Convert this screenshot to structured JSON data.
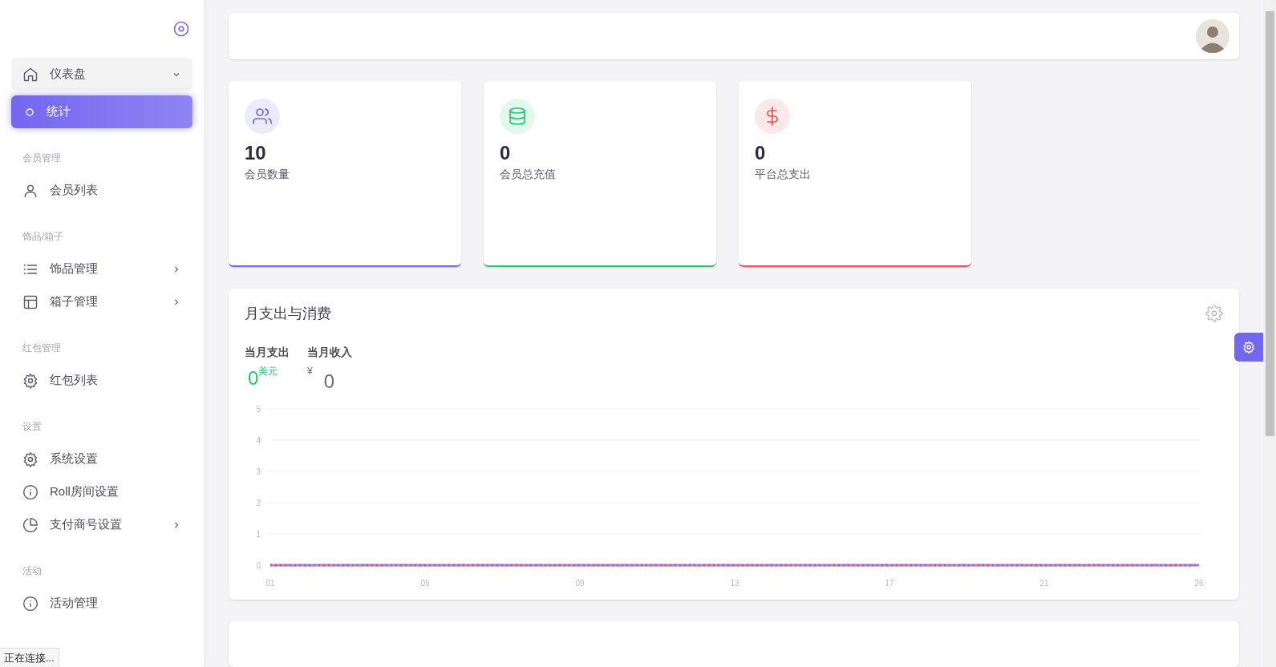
{
  "sidebar": {
    "items": [
      {
        "kind": "group",
        "label": "仪表盘",
        "selected": false,
        "expanded": true,
        "children": [
          {
            "label": "统计",
            "selected": true
          }
        ]
      },
      {
        "kind": "header",
        "label": "会员管理"
      },
      {
        "kind": "link",
        "label": "会员列表",
        "selected": false
      },
      {
        "kind": "header",
        "label": "饰品/箱子"
      },
      {
        "kind": "group",
        "label": "饰品管理",
        "selected": false,
        "expanded": false
      },
      {
        "kind": "group",
        "label": "箱子管理",
        "selected": false,
        "expanded": false
      },
      {
        "kind": "header",
        "label": "红包管理"
      },
      {
        "kind": "link",
        "label": "红包列表",
        "selected": false
      },
      {
        "kind": "header",
        "label": "设置"
      },
      {
        "kind": "link",
        "label": "系统设置",
        "selected": false
      },
      {
        "kind": "link",
        "label": "Roll房间设置",
        "selected": false
      },
      {
        "kind": "group",
        "label": "支付商号设置",
        "selected": false,
        "expanded": false
      },
      {
        "kind": "header",
        "label": "活动"
      },
      {
        "kind": "link",
        "label": "活动管理",
        "selected": false
      }
    ]
  },
  "stats": [
    {
      "value": "10",
      "label": "会员数量",
      "color": "#7367f0"
    },
    {
      "value": "0",
      "label": "会员总充值",
      "color": "#28c76f"
    },
    {
      "value": "0",
      "label": "平台总支出",
      "color": "#ea5455"
    }
  ],
  "chart_card": {
    "title": "月支出与消费",
    "summary": [
      {
        "label": "当月支出",
        "value": "0",
        "unit": "美元",
        "color": "#28c76f",
        "kind": "suffix"
      },
      {
        "label": "当月收入",
        "value": "0",
        "unit": "¥",
        "color": "#6e6b7b",
        "kind": "prefix"
      }
    ],
    "chart_data": {
      "type": "line",
      "categories": [
        "01",
        "05",
        "09",
        "13",
        "17",
        "21",
        "26"
      ],
      "yticks": [
        0,
        1,
        2,
        3,
        4,
        5
      ],
      "ylim": [
        0,
        5
      ],
      "grid": true,
      "series": [
        {
          "color": "#ea5455",
          "line_style": "dashed",
          "values": [
            0,
            0,
            0,
            0,
            0,
            0,
            0
          ]
        },
        {
          "color": "#7367f0",
          "line_style": "dashed",
          "values": [
            0,
            0,
            0,
            0,
            0,
            0,
            0
          ]
        }
      ]
    }
  },
  "status_bar": "正在连接..."
}
